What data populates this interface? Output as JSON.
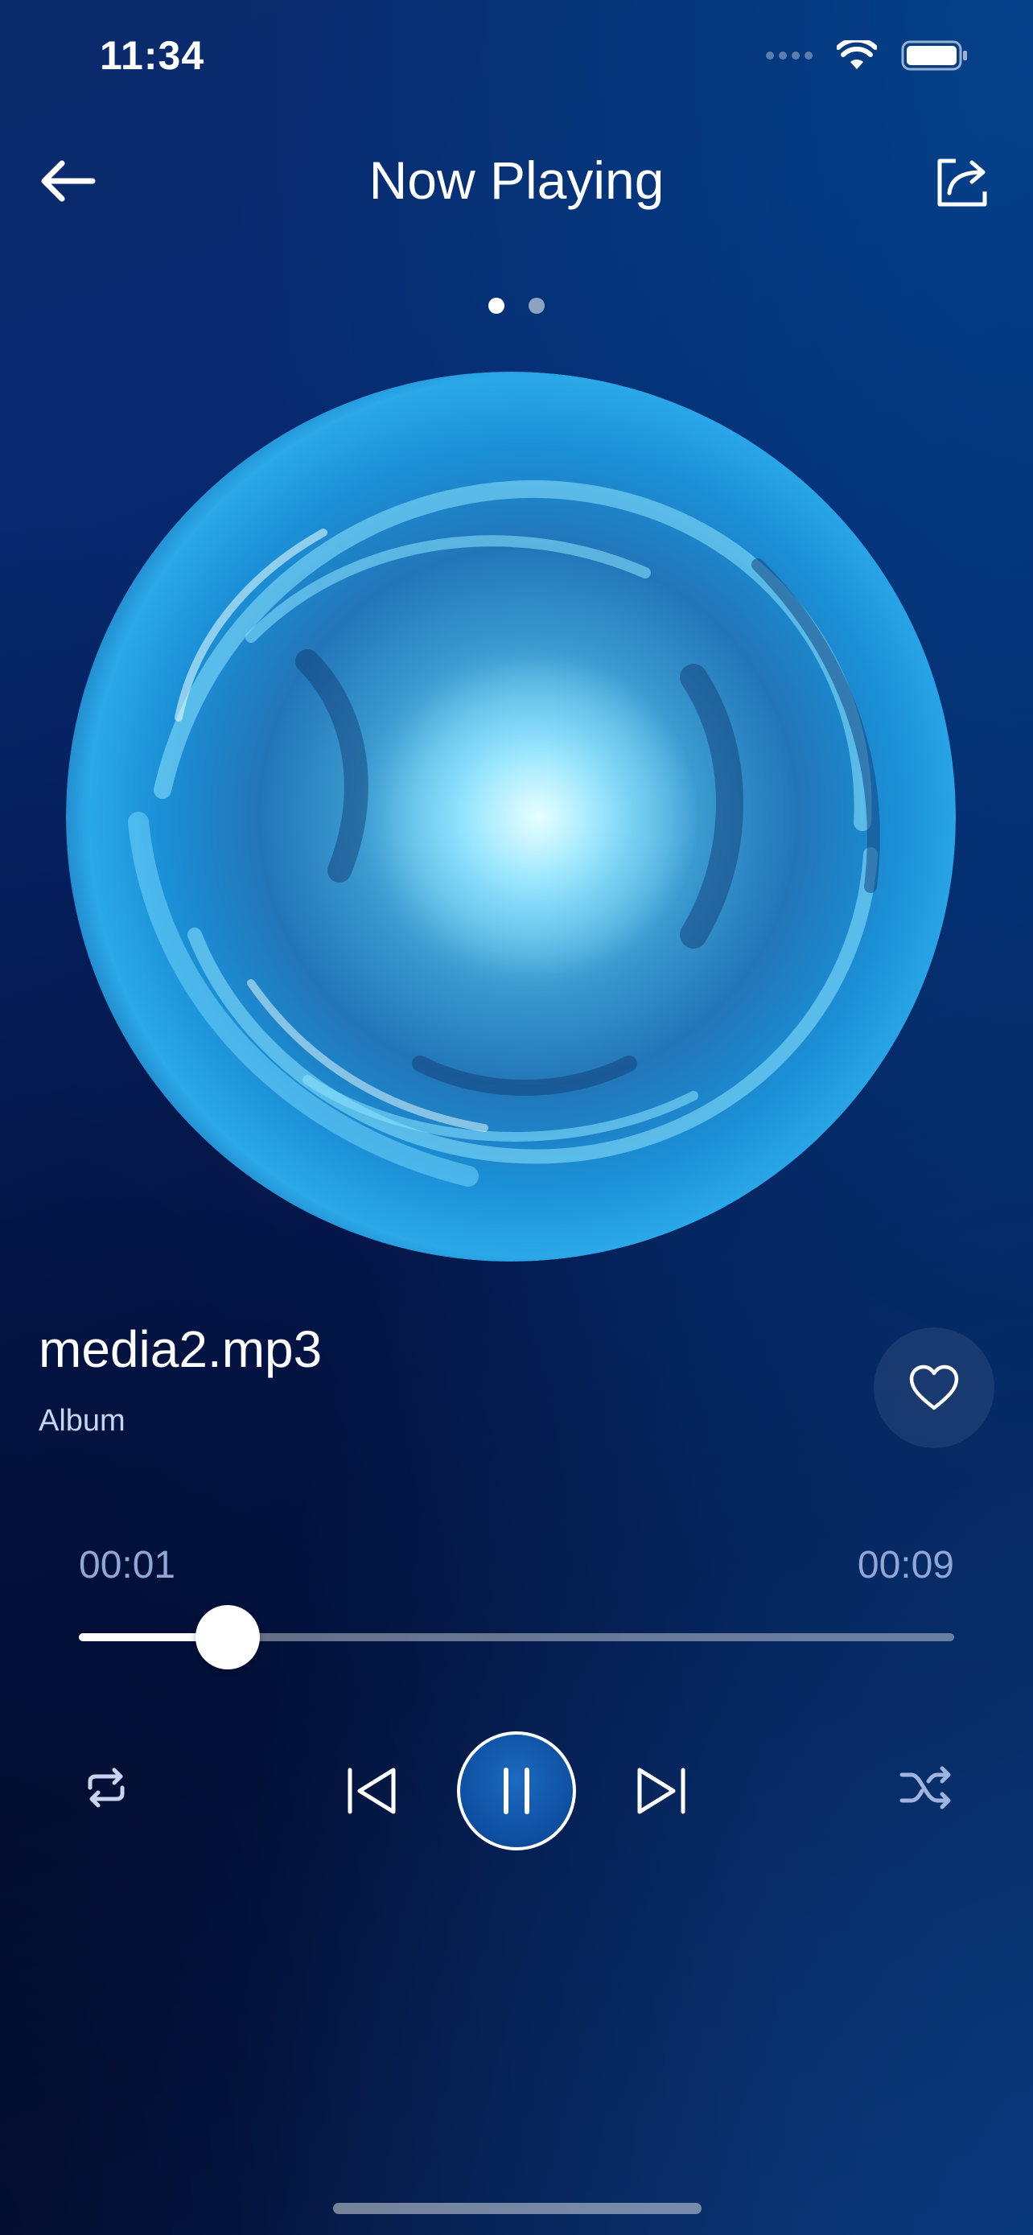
{
  "status_bar": {
    "time": "11:34",
    "icons": [
      "signal-icon",
      "wifi-icon",
      "battery-icon"
    ]
  },
  "header": {
    "title": "Now Playing",
    "back_icon": "back-arrow-icon",
    "share_icon": "share-icon"
  },
  "pager": {
    "pages": 2,
    "active_index": 0
  },
  "track": {
    "title": "media2.mp3",
    "album": "Album",
    "favorite_icon": "heart-outline-icon"
  },
  "progress": {
    "elapsed": "00:01",
    "total": "00:09",
    "fraction": 0.17
  },
  "controls": {
    "repeat_icon": "repeat-icon",
    "previous_icon": "skip-previous-icon",
    "play_pause_icon": "pause-icon",
    "next_icon": "skip-next-icon",
    "shuffle_icon": "shuffle-icon"
  },
  "colors": {
    "background_top": "#0a2a6a",
    "background_bottom": "#03184a",
    "accent": "#0d4ea0",
    "time_text": "#8fa6d6",
    "album_text": "#c9d4f0"
  }
}
